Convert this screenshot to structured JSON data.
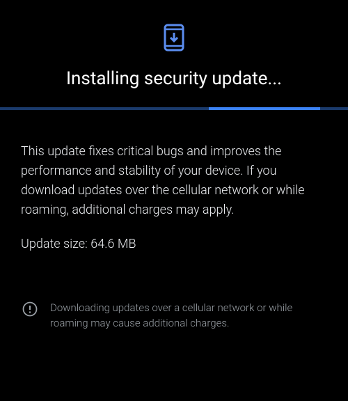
{
  "colors": {
    "accent": "#5b8def",
    "progress_track": "#1a3a6b",
    "progress_bar": "#3b82f6",
    "text_primary": "#e8eaed",
    "text_secondary": "#9aa0a6"
  },
  "header": {
    "icon": "phone-download-icon",
    "title": "Installing security update..."
  },
  "body": {
    "description": "This update fixes critical bugs and improves the performance and stability of your device. If you download updates over the cellular network or while roaming, additional charges may apply.",
    "update_size_line": "Update size: 64.6 MB"
  },
  "warning": {
    "icon": "alert-circle-icon",
    "text": "Downloading updates over a cellular network or while roaming may cause additional charges."
  }
}
